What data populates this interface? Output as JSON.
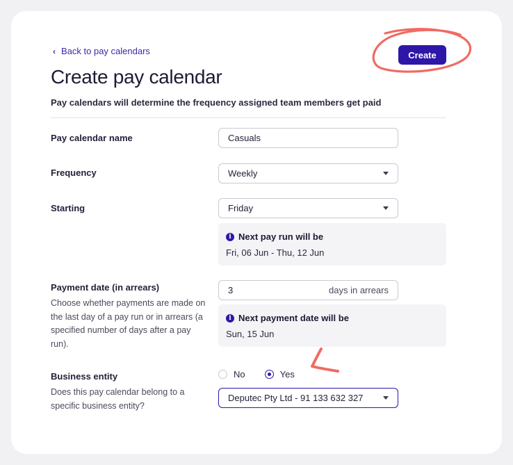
{
  "header": {
    "back_label": "Back to pay calendars",
    "create_label": "Create",
    "title": "Create pay calendar",
    "subtitle": "Pay calendars will determine the frequency assigned team members get paid"
  },
  "form": {
    "name": {
      "label": "Pay calendar name",
      "value": "Casuals"
    },
    "frequency": {
      "label": "Frequency",
      "value": "Weekly"
    },
    "starting": {
      "label": "Starting",
      "value": "Friday",
      "info_title": "Next pay run will be",
      "info_value": "Fri, 06 Jun - Thu, 12 Jun"
    },
    "payment_date": {
      "label": "Payment date (in arrears)",
      "help": "Choose whether payments are made on the last day of a pay run or in arrears (a specified number of days after a pay run).",
      "value": "3",
      "suffix": "days in arrears",
      "info_title": "Next payment date will be",
      "info_value": "Sun, 15 Jun"
    },
    "business_entity": {
      "label": "Business entity",
      "help": "Does this pay calendar belong to a specific business entity?",
      "option_no": "No",
      "option_yes": "Yes",
      "selected": "Yes",
      "entity_value": "Deputec Pty Ltd - 91 133 632 327"
    }
  },
  "colors": {
    "accent": "#2e17a8",
    "annotation": "#f06b62",
    "background": "#f1f1f4",
    "info_box": "#f4f4f7"
  },
  "icons": {
    "back": "chevron-left-icon",
    "info": "info-icon",
    "caret": "caret-down-icon"
  }
}
